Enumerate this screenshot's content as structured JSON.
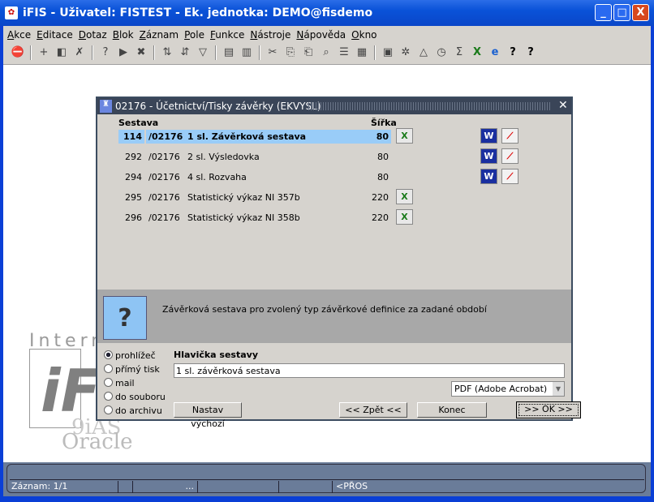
{
  "window": {
    "title": "iFIS - Uživatel: FISTEST - Ek. jednotka: DEMO@fisdemo",
    "minimize": "_",
    "maximize": "□",
    "close": "X"
  },
  "menu": [
    "Akce",
    "Editace",
    "Dotaz",
    "Blok",
    "Záznam",
    "Pole",
    "Funkce",
    "Nástroje",
    "Nápověda",
    "Okno"
  ],
  "toolbar": [
    {
      "name": "exit-icon",
      "g": "⛔"
    },
    {
      "sep": true
    },
    {
      "name": "insert-record-icon",
      "g": "+"
    },
    {
      "name": "save-icon",
      "g": "◧"
    },
    {
      "name": "delete-record-icon",
      "g": "✗"
    },
    {
      "sep": true
    },
    {
      "name": "enter-query-icon",
      "g": "?"
    },
    {
      "name": "execute-query-icon",
      "g": "▶"
    },
    {
      "name": "cancel-query-icon",
      "g": "✖"
    },
    {
      "sep": true
    },
    {
      "name": "sort-asc-icon",
      "g": "⇅"
    },
    {
      "name": "sort-desc-icon",
      "g": "⇵"
    },
    {
      "name": "filter-icon",
      "g": "▽"
    },
    {
      "sep": true
    },
    {
      "name": "print-icon",
      "g": "▤"
    },
    {
      "name": "print-setup-icon",
      "g": "▥"
    },
    {
      "sep": true
    },
    {
      "name": "cut-icon",
      "g": "✂"
    },
    {
      "name": "copy-icon",
      "g": "⎘"
    },
    {
      "name": "paste-icon",
      "g": "⎗"
    },
    {
      "name": "find-icon",
      "g": "⌕"
    },
    {
      "name": "list-icon",
      "g": "☰"
    },
    {
      "name": "columns-icon",
      "g": "▦"
    },
    {
      "sep": true
    },
    {
      "name": "calculator-icon",
      "g": "▣"
    },
    {
      "name": "settings-icon",
      "g": "✲"
    },
    {
      "name": "triangle-icon",
      "g": "△"
    },
    {
      "name": "clock-icon",
      "g": "◷"
    },
    {
      "name": "sum-icon",
      "g": "Σ"
    },
    {
      "name": "excel-icon",
      "g": "X"
    },
    {
      "name": "browser-icon",
      "g": "e"
    },
    {
      "name": "help-icon",
      "g": "?"
    },
    {
      "name": "context-help-icon",
      "g": "?"
    }
  ],
  "logo": {
    "text1": "Interne",
    "text2": "9iAS",
    "text3": "Oracle"
  },
  "status": {
    "record": "Záznam: 1/1",
    "ellipsis": "...",
    "mode": "<PŘOS"
  },
  "dialog": {
    "title": "02176 - Účetnictví/Tisky závěrky (EKVYSL)",
    "col_sestava": "Sestava",
    "col_sirka": "Šířka",
    "rows": [
      {
        "num": "114",
        "code": "/02176",
        "name": "1 sl. Závěrková sestava",
        "width": "80",
        "excel": true,
        "word": true,
        "pdf": true,
        "selected": true
      },
      {
        "num": "292",
        "code": "/02176",
        "name": "2 sl. Výsledovka",
        "width": "80",
        "excel": false,
        "word": true,
        "pdf": true
      },
      {
        "num": "294",
        "code": "/02176",
        "name": "4 sl. Rozvaha",
        "width": "80",
        "excel": false,
        "word": true,
        "pdf": true
      },
      {
        "num": "295",
        "code": "/02176",
        "name": "Statistický výkaz NI 357b",
        "width": "220",
        "excel": true,
        "word": false,
        "pdf": false
      },
      {
        "num": "296",
        "code": "/02176",
        "name": "Statistický výkaz NI 358b",
        "width": "220",
        "excel": true,
        "word": false,
        "pdf": false
      }
    ],
    "description": "Závěrková sestava pro zvolený typ závěrkové definice za zadané období",
    "output_options": [
      "prohlížeč",
      "přímý tisk",
      "mail",
      "do souboru",
      "do archivu"
    ],
    "output_selected": 0,
    "header_label": "Hlavička sestavy",
    "header_value": "1 sl. závěrková sestava",
    "format_value": "PDF (Adobe Acrobat)",
    "btn_default": "Nastav výchozí",
    "btn_back": "<< Zpět <<",
    "btn_end": "Konec",
    "btn_ok": ">> OK >>"
  }
}
